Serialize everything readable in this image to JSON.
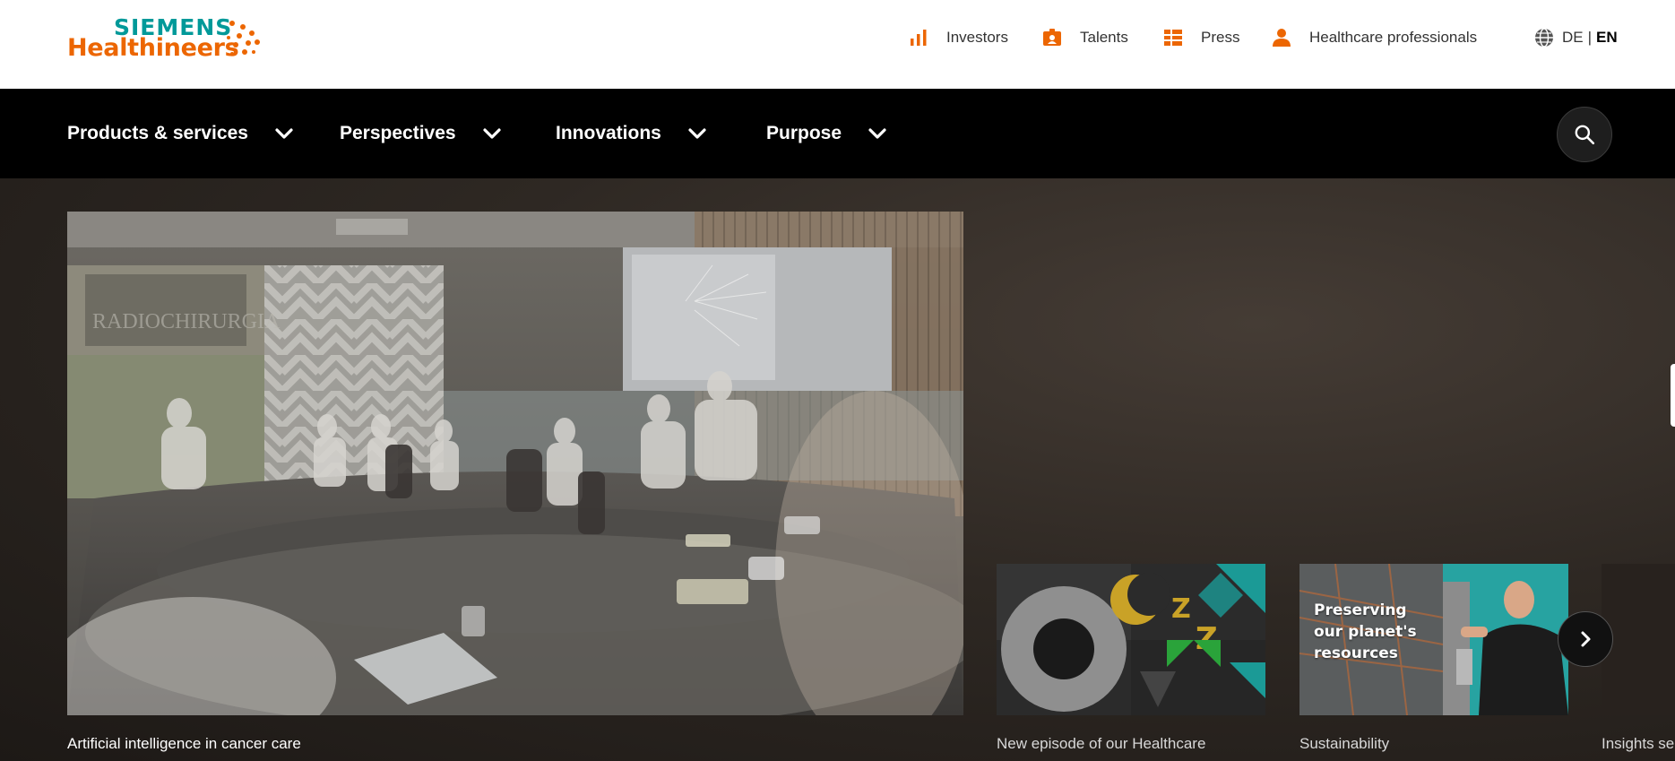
{
  "brand": {
    "line1": "SIEMENS",
    "line2": "Healthineers",
    "primary_color": "#ec6602",
    "secondary_color": "#009999"
  },
  "util_nav": [
    {
      "label": "Investors",
      "icon": "bar-chart-icon"
    },
    {
      "label": "Talents",
      "icon": "id-badge-icon"
    },
    {
      "label": "Press",
      "icon": "newspaper-list-icon"
    },
    {
      "label": "Healthcare professionals",
      "icon": "person-icon"
    }
  ],
  "language": {
    "icon": "globe-icon",
    "options": [
      "DE",
      "EN"
    ],
    "separator": "|",
    "active": "EN"
  },
  "main_nav": [
    {
      "label": "Products & services"
    },
    {
      "label": "Perspectives"
    },
    {
      "label": "Innovations"
    },
    {
      "label": "Purpose"
    }
  ],
  "hero": {
    "main_caption": "Artificial intelligence in cancer care",
    "cards": [
      {
        "caption": "New episode of our Healthcare"
      },
      {
        "caption": "Sustainability",
        "overlay_text": [
          "Preserving",
          "our planet's",
          "resources"
        ]
      },
      {
        "caption": "Insights se"
      }
    ]
  }
}
